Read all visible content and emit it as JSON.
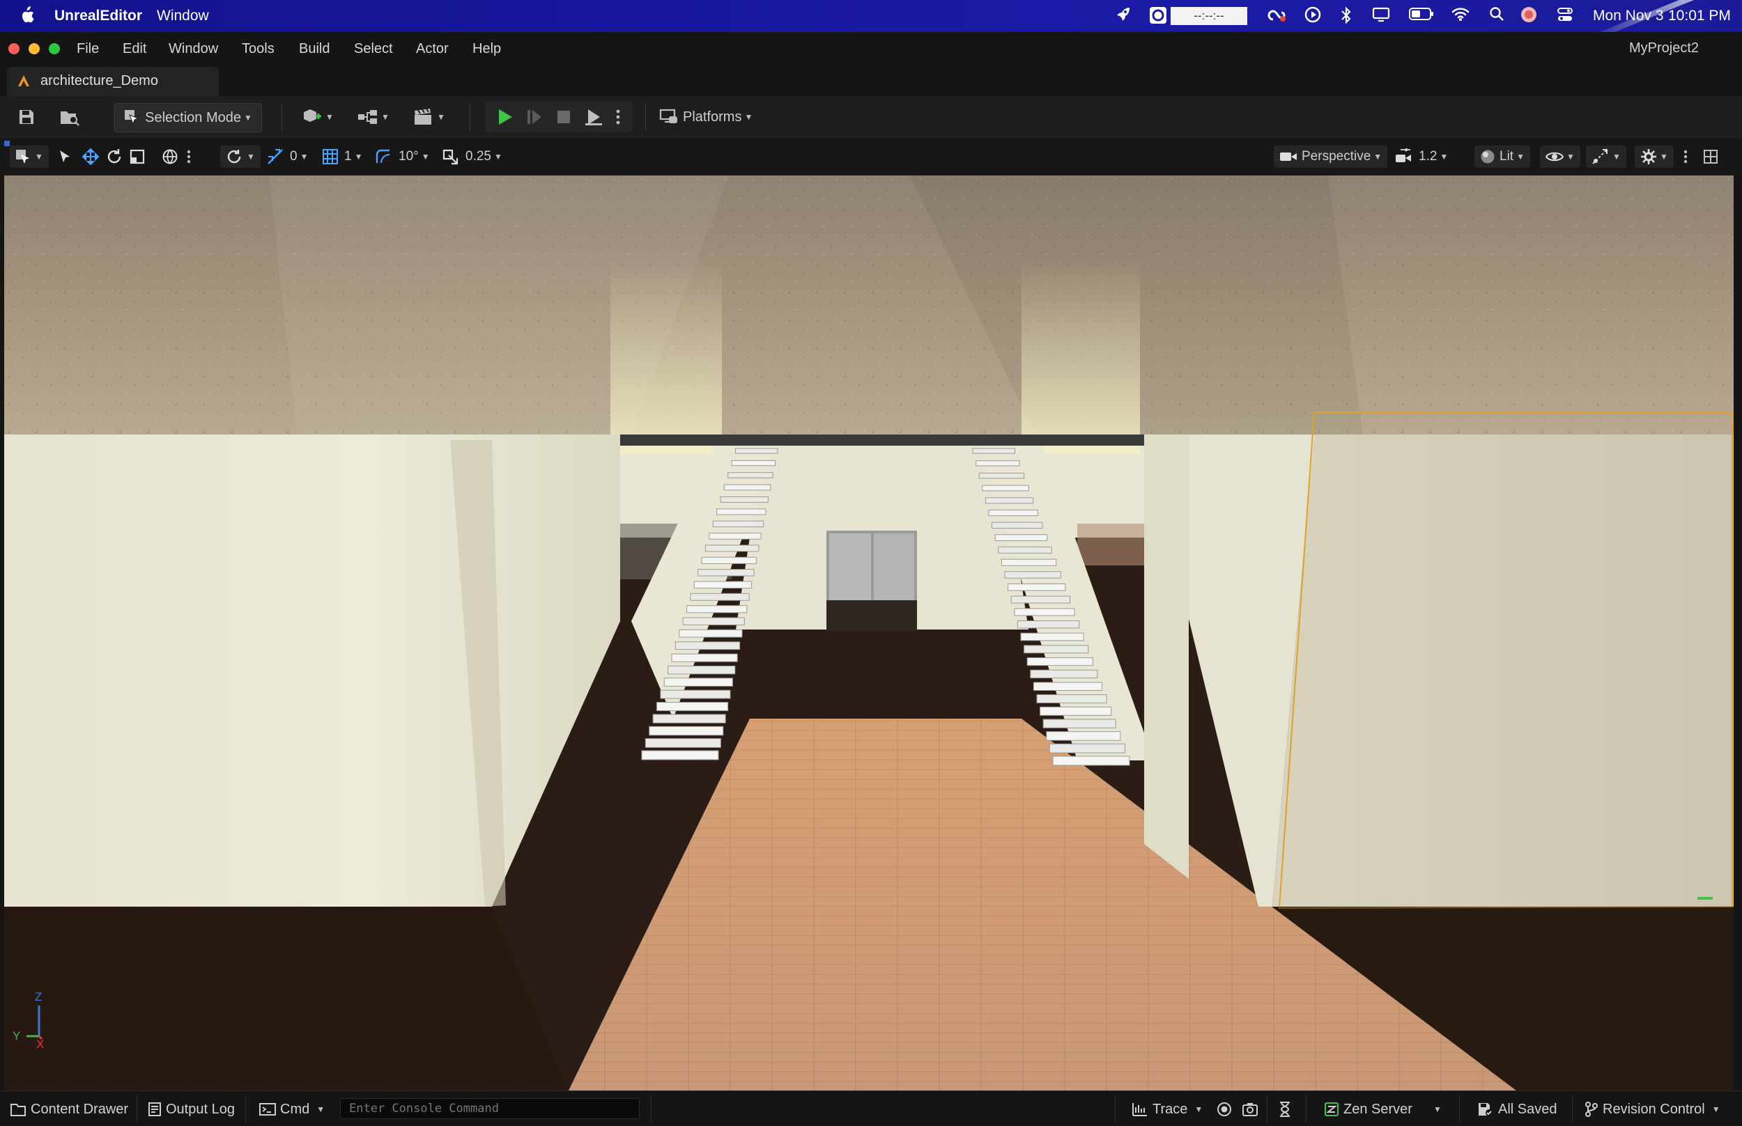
{
  "menubar": {
    "app_name": "UnrealEditor",
    "window_menu": "Window",
    "time_field": "--:--:--",
    "date": "Mon Nov 3",
    "time": "10:01 PM",
    "icons": [
      "apple-icon",
      "rocket-icon",
      "time-tracker-icon",
      "creative-cloud-icon",
      "play-circle-icon",
      "bluetooth-icon",
      "display-icon",
      "battery-icon",
      "wifi-icon",
      "search-icon",
      "user-avatar-icon",
      "control-center-icon"
    ]
  },
  "titlebar": {
    "menu": [
      "File",
      "Edit",
      "Window",
      "Tools",
      "Build",
      "Select",
      "Actor",
      "Help"
    ],
    "project": "MyProject2"
  },
  "tab": {
    "label": "architecture_Demo"
  },
  "toolbar": {
    "selection_mode": "Selection Mode",
    "platforms": "Platforms"
  },
  "viewport_toolbar": {
    "translate_snap": "0",
    "grid_snap": "1",
    "rotation_snap": "10°",
    "scale_snap": "0.25",
    "view_mode": "Perspective",
    "camera_speed": "1.2",
    "lighting": "Lit"
  },
  "axis": {
    "z": "Z",
    "y": "Y",
    "x": "X"
  },
  "statusbar": {
    "content_drawer": "Content Drawer",
    "output_log": "Output Log",
    "cmd": "Cmd",
    "console_placeholder": "Enter Console Command",
    "trace": "Trace",
    "zen_server": "Zen Server",
    "all_saved": "All Saved",
    "revision_control": "Revision Control"
  },
  "colors": {
    "menubar": "#1b1aa6",
    "play_green": "#44c24c",
    "selection_outline": "#e0a12a"
  }
}
